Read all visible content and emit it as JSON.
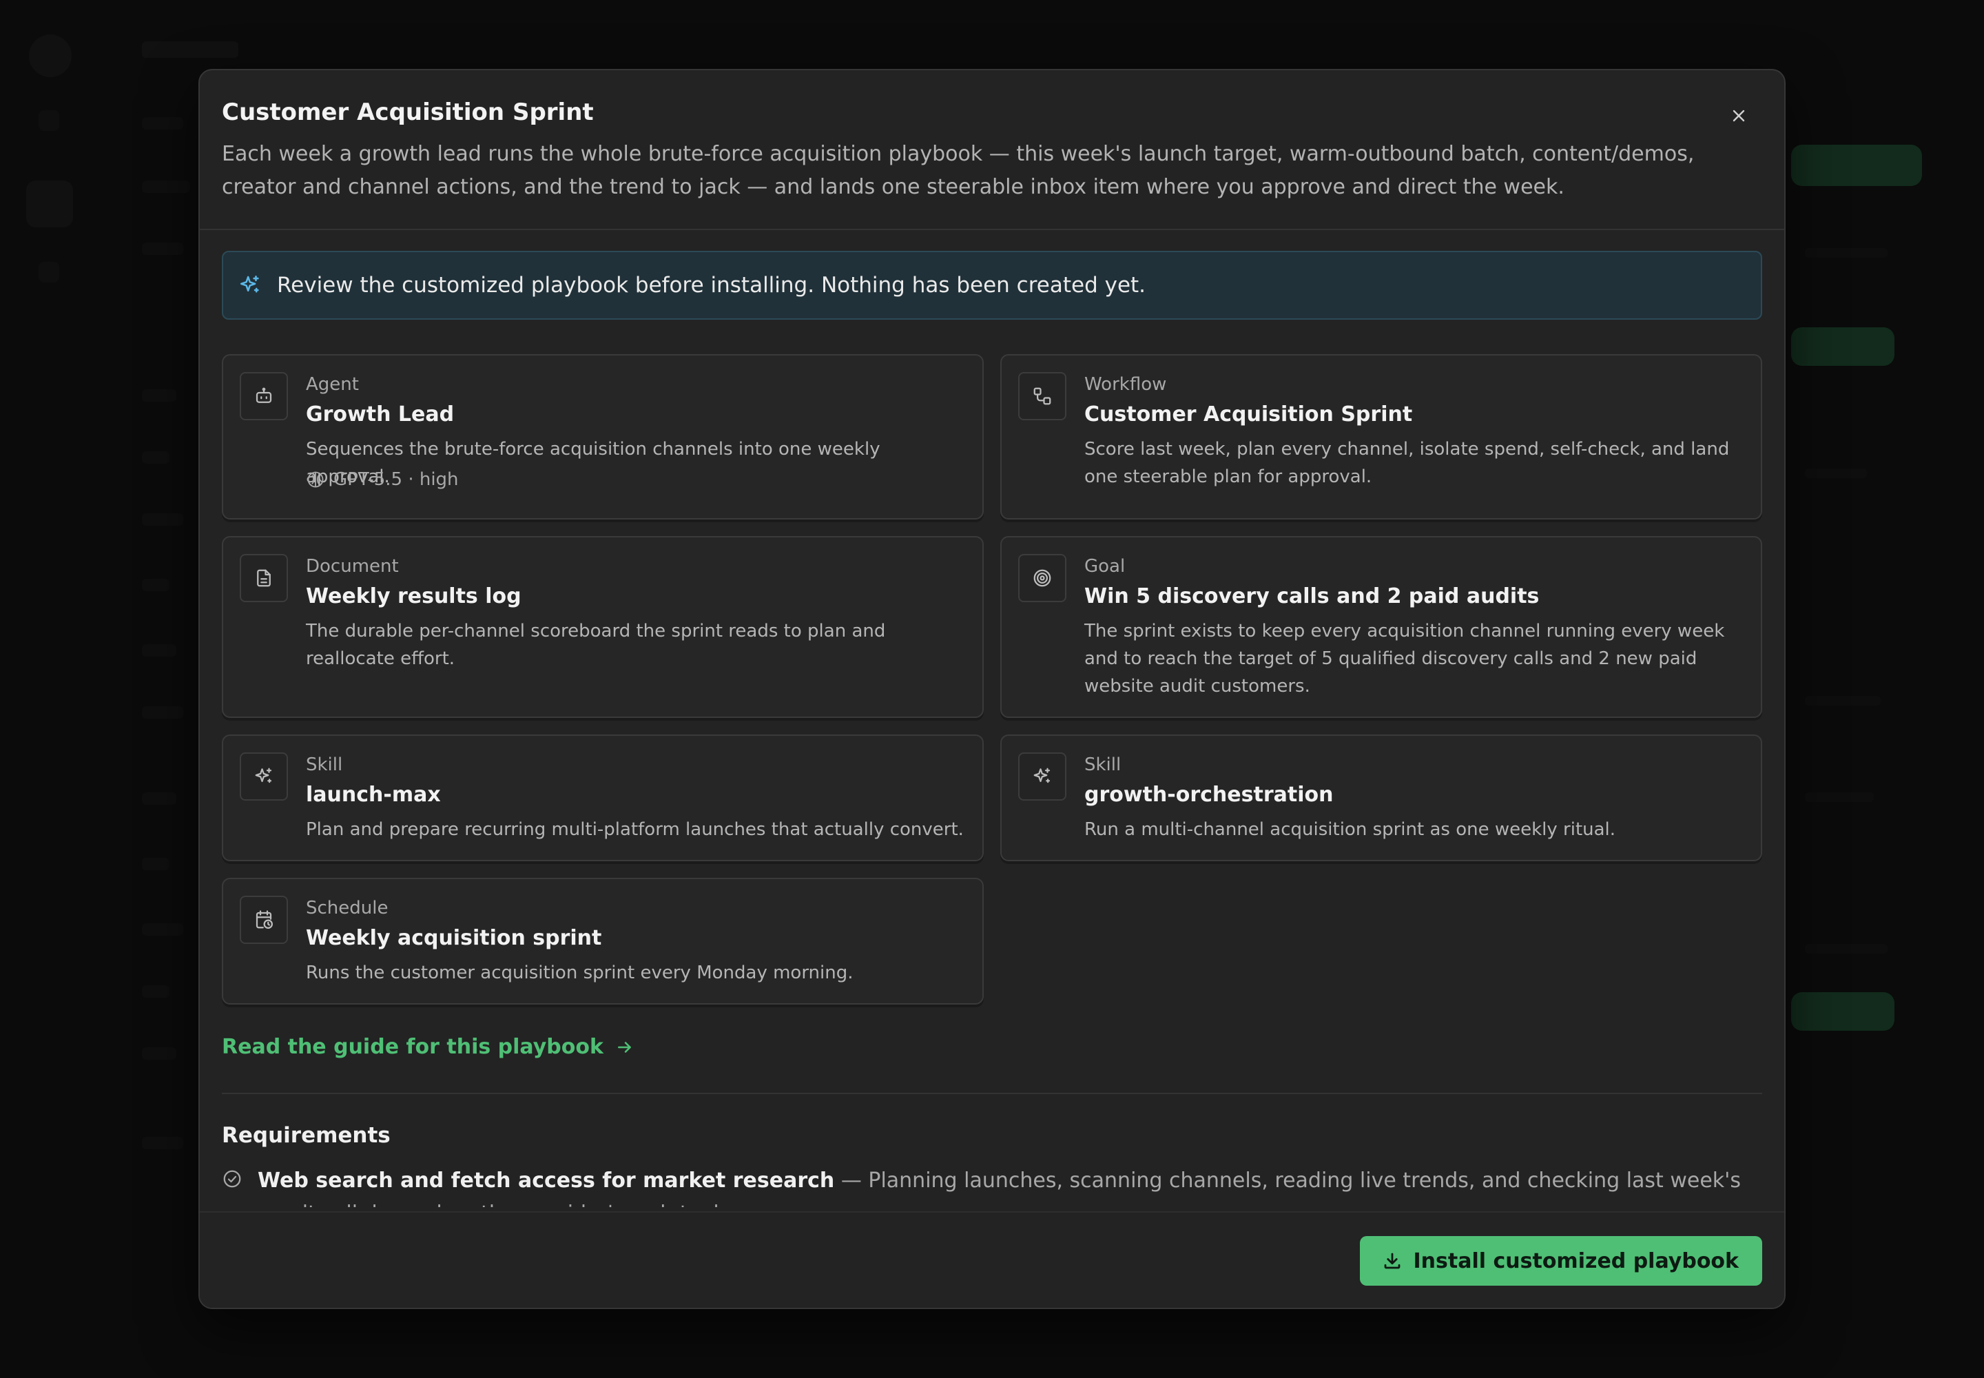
{
  "modal": {
    "title": "Customer Acquisition Sprint",
    "description": "Each week a growth lead runs the whole brute-force acquisition playbook — this week's launch target, warm-outbound batch, content/demos, creator and channel actions, and the trend to jack — and lands one steerable inbox item where you approve and direct the week.",
    "close_icon": "close-icon"
  },
  "notice": {
    "icon": "sparkles-icon",
    "text": "Review the customized playbook before installing. Nothing has been created yet."
  },
  "cards": [
    {
      "kind": "Agent",
      "title": "Growth Lead",
      "description": "Sequences the brute-force acquisition channels into one weekly approval.",
      "meta": "GPT-5.5 · high",
      "icon": "bot-icon"
    },
    {
      "kind": "Workflow",
      "title": "Customer Acquisition Sprint",
      "description": "Score last week, plan every channel, isolate spend, self-check, and land one steerable plan for approval.",
      "icon": "workflow-icon"
    },
    {
      "kind": "Document",
      "title": "Weekly results log",
      "description": "The durable per-channel scoreboard the sprint reads to plan and reallocate effort.",
      "icon": "document-icon"
    },
    {
      "kind": "Goal",
      "title": "Win 5 discovery calls and 2 paid audits",
      "description": "The sprint exists to keep every acquisition channel running every week and to reach the target of 5 qualified discovery calls and 2 new paid website audit customers.",
      "icon": "target-icon"
    },
    {
      "kind": "Skill",
      "title": "launch-max",
      "description": "Plan and prepare recurring multi-platform launches that actually convert.",
      "icon": "sparkles-icon"
    },
    {
      "kind": "Skill",
      "title": "growth-orchestration",
      "description": "Run a multi-channel acquisition sprint as one weekly ritual.",
      "icon": "sparkles-icon"
    },
    {
      "kind": "Schedule",
      "title": "Weekly acquisition sprint",
      "description": "Runs the customer acquisition sprint every Monday morning.",
      "icon": "calendar-clock-icon"
    }
  ],
  "guide_link": {
    "label": "Read the guide for this playbook",
    "icon": "arrow-right-icon"
  },
  "requirements": {
    "heading": "Requirements",
    "items": [
      {
        "title": "Web search and fetch access for market research",
        "detail": " — Planning launches, scanning channels, reading live trends, and checking last week's results all depend on the provider's web tools.",
        "icon": "check-circle-icon"
      }
    ]
  },
  "footer": {
    "install_label": "Install customized playbook",
    "install_icon": "download-icon"
  },
  "colors": {
    "accent": "#4fbf75",
    "modal_bg": "#232323",
    "card_bg": "#262626",
    "notice_bg": "#213139",
    "backdrop": "#0f0f0f"
  }
}
